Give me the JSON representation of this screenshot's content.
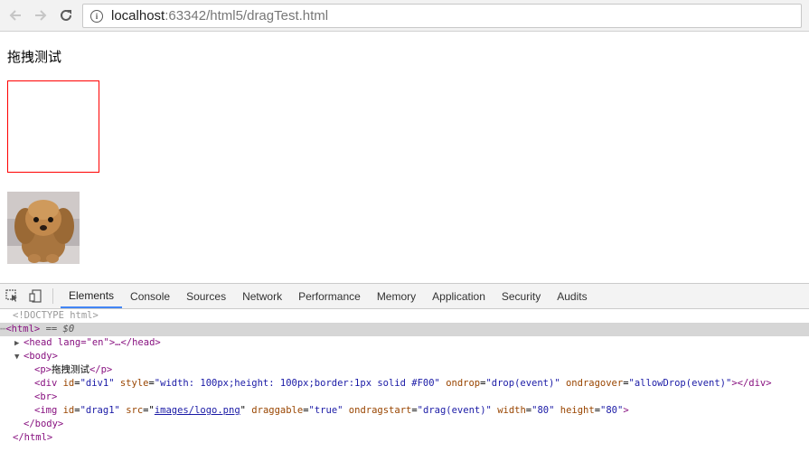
{
  "browser": {
    "url_host": "localhost",
    "url_rest": ":63342/html5/dragTest.html"
  },
  "page": {
    "heading": "拖拽测试"
  },
  "devtools": {
    "tabs": [
      "Elements",
      "Console",
      "Sources",
      "Network",
      "Performance",
      "Memory",
      "Application",
      "Security",
      "Audits"
    ],
    "active_tab": "Elements",
    "dom": {
      "doctype": "<!DOCTYPE html>",
      "html_open": "<html>",
      "selected_marker": " == $0",
      "head_line": "<head lang=\"en\">…</head>",
      "body_open": "<body>",
      "p_open": "<p>",
      "p_text": "拖拽测试",
      "p_close": "</p>",
      "div_tag": "<div ",
      "div_id_name": "id",
      "div_id_val": "\"div1\"",
      "div_style_name": "style",
      "div_style_val": "\"width: 100px;height: 100px;border:1px solid #F00\"",
      "div_drop_name": "ondrop",
      "div_drop_val": "\"drop(event)\"",
      "div_over_name": "ondragover",
      "div_over_val": "\"allowDrop(event)\"",
      "div_close": "></div>",
      "br": "<br>",
      "img_tag": "<img ",
      "img_id_name": "id",
      "img_id_val": "\"drag1\"",
      "img_src_name": "src",
      "img_src_val": "images/logo.png",
      "img_drag_name": "draggable",
      "img_drag_val": "\"true\"",
      "img_start_name": "ondragstart",
      "img_start_val": "\"drag(event)\"",
      "img_w_name": "width",
      "img_w_val": "\"80\"",
      "img_h_name": "height",
      "img_h_val": "\"80\"",
      "body_close": "</body>",
      "html_close": "</html>"
    }
  }
}
